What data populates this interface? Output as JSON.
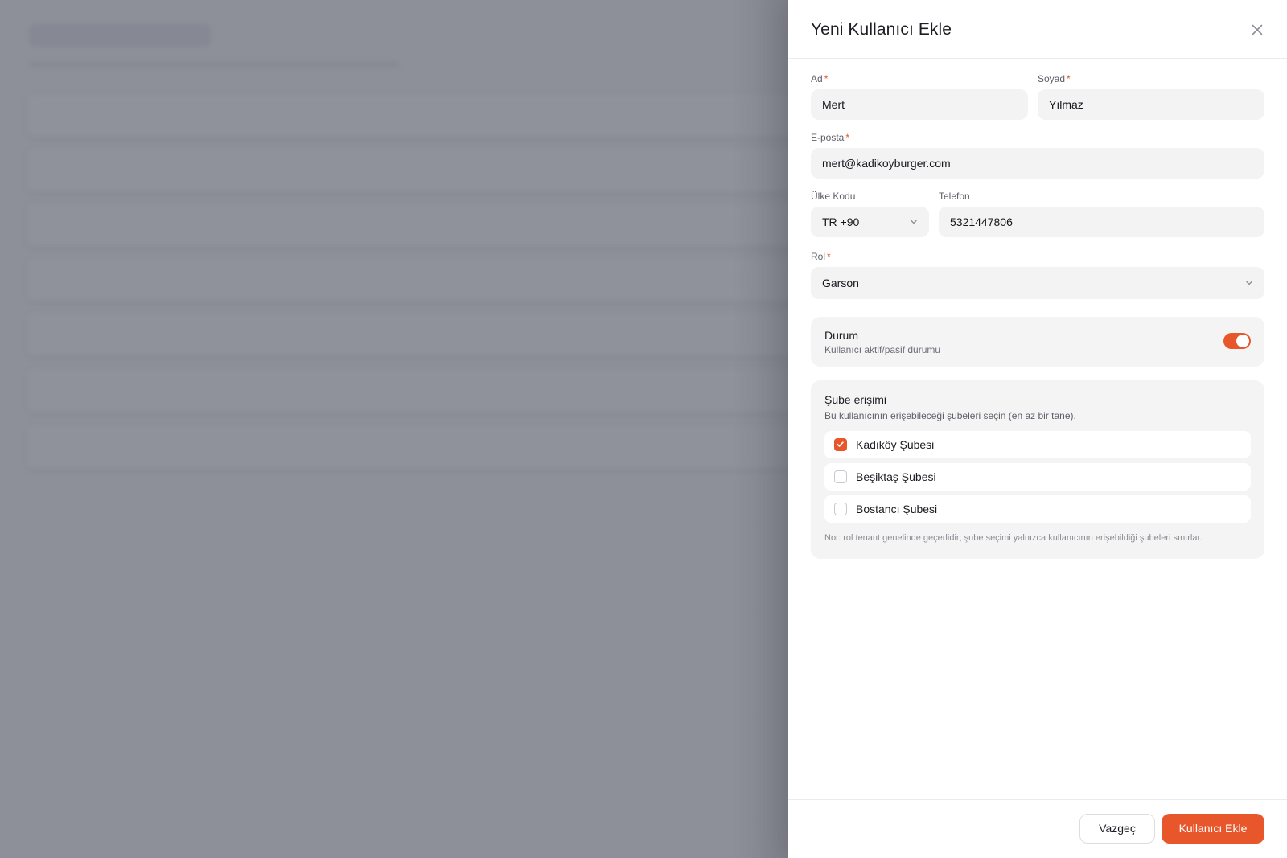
{
  "drawer": {
    "title": "Yeni Kullanıcı Ekle"
  },
  "form": {
    "first_name": {
      "label": "Ad",
      "required_mark": "*",
      "value": "Mert"
    },
    "last_name": {
      "label": "Soyad",
      "required_mark": "*",
      "value": "Yılmaz"
    },
    "email": {
      "label": "E-posta",
      "required_mark": "*",
      "value": "mert@kadikoyburger.com"
    },
    "country_code": {
      "label": "Ülke Kodu",
      "value": "TR +90"
    },
    "phone": {
      "label": "Telefon",
      "value": "5321447806"
    },
    "role": {
      "label": "Rol",
      "required_mark": "*",
      "value": "Garson"
    }
  },
  "status": {
    "title": "Durum",
    "subtitle": "Kullanıcı aktif/pasif durumu",
    "enabled": true,
    "accent_color": "#e8572b"
  },
  "branch_access": {
    "title": "Şube erişimi",
    "subtitle": "Bu kullanıcının erişebileceği şubeleri seçin (en az bir tane).",
    "items": [
      {
        "label": "Kadıköy Şubesi",
        "checked": true
      },
      {
        "label": "Beşiktaş Şubesi",
        "checked": false
      },
      {
        "label": "Bostancı Şubesi",
        "checked": false
      }
    ],
    "note": "Not: rol tenant genelinde geçerlidir; şube seçimi yalnızca kullanıcının erişebildiği şubeleri sınırlar."
  },
  "footer": {
    "cancel_label": "Vazgeç",
    "submit_label": "Kullanıcı Ekle"
  }
}
